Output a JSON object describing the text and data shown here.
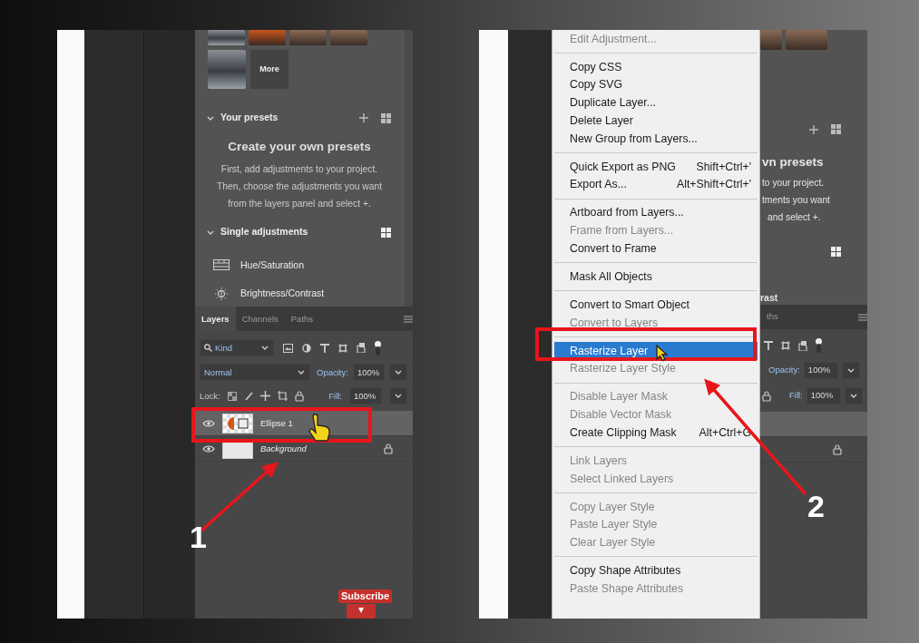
{
  "left_screenshot": {
    "presets": {
      "more_label": "More"
    },
    "your_presets": {
      "title": "Your presets",
      "heading": "Create your own presets",
      "lines": [
        "First, add adjustments to your project.",
        "Then, choose the adjustments you want",
        "from the layers panel and select +."
      ]
    },
    "single_adjustments": {
      "title": "Single adjustments",
      "items": [
        {
          "label": "Hue/Saturation",
          "kind": "hue"
        },
        {
          "label": "Brightness/Contrast",
          "kind": "brightness"
        }
      ]
    },
    "layers_panel": {
      "tabs": [
        {
          "label": "Layers",
          "selected": true
        },
        {
          "label": "Channels",
          "selected": false
        },
        {
          "label": "Paths",
          "selected": false
        }
      ],
      "filter": "Kind",
      "blend_mode": "Normal",
      "opacity_label": "Opacity:",
      "opacity": "100%",
      "lock_label": "Lock:",
      "fill_label": "Fill:",
      "fill": "100%",
      "layers": [
        {
          "name": "Ellipse 1",
          "kind": "shape",
          "selected": true,
          "locked": false
        },
        {
          "name": "Background",
          "kind": "plain",
          "selected": false,
          "locked": true
        }
      ]
    },
    "subscribe_badge": "Subscribe"
  },
  "right_screenshot": {
    "context_menu": {
      "items": [
        {
          "kind": "item",
          "label": "Edit Adjustment...",
          "disabled": true,
          "selected": false
        },
        {
          "kind": "separator"
        },
        {
          "kind": "item",
          "label": "Copy CSS",
          "disabled": false,
          "selected": false
        },
        {
          "kind": "item",
          "label": "Copy SVG",
          "disabled": false,
          "selected": false
        },
        {
          "kind": "item",
          "label": "Duplicate Layer...",
          "disabled": false,
          "selected": false
        },
        {
          "kind": "item",
          "label": "Delete Layer",
          "disabled": false,
          "selected": false
        },
        {
          "kind": "item",
          "label": "New Group from Layers...",
          "disabled": false,
          "selected": false
        },
        {
          "kind": "separator"
        },
        {
          "kind": "item",
          "label": "Quick Export as PNG",
          "shortcut": "Shift+Ctrl+'",
          "disabled": false,
          "selected": false
        },
        {
          "kind": "item",
          "label": "Export As...",
          "shortcut": "Alt+Shift+Ctrl+'",
          "disabled": false,
          "selected": false
        },
        {
          "kind": "separator"
        },
        {
          "kind": "item",
          "label": "Artboard from Layers...",
          "disabled": false,
          "selected": false
        },
        {
          "kind": "item",
          "label": "Frame from Layers...",
          "disabled": true,
          "selected": false
        },
        {
          "kind": "item",
          "label": "Convert to Frame",
          "disabled": false,
          "selected": false
        },
        {
          "kind": "separator"
        },
        {
          "kind": "item",
          "label": "Mask All Objects",
          "disabled": false,
          "selected": false
        },
        {
          "kind": "separator"
        },
        {
          "kind": "item",
          "label": "Convert to Smart Object",
          "disabled": false,
          "selected": false
        },
        {
          "kind": "item",
          "label": "Convert to Layers",
          "disabled": true,
          "selected": false
        },
        {
          "kind": "separator"
        },
        {
          "kind": "item",
          "label": "Rasterize Layer",
          "disabled": false,
          "selected": true
        },
        {
          "kind": "item",
          "label": "Rasterize Layer Style",
          "disabled": true,
          "selected": false
        },
        {
          "kind": "separator"
        },
        {
          "kind": "item",
          "label": "Disable Layer Mask",
          "disabled": true,
          "selected": false
        },
        {
          "kind": "item",
          "label": "Disable Vector Mask",
          "disabled": true,
          "selected": false
        },
        {
          "kind": "item",
          "label": "Create Clipping Mask",
          "shortcut": "Alt+Ctrl+G",
          "disabled": false,
          "selected": false
        },
        {
          "kind": "separator"
        },
        {
          "kind": "item",
          "label": "Link Layers",
          "disabled": true,
          "selected": false
        },
        {
          "kind": "item",
          "label": "Select Linked Layers",
          "disabled": true,
          "selected": false
        },
        {
          "kind": "separator"
        },
        {
          "kind": "item",
          "label": "Copy Layer Style",
          "disabled": true,
          "selected": false
        },
        {
          "kind": "item",
          "label": "Paste Layer Style",
          "disabled": true,
          "selected": false
        },
        {
          "kind": "item",
          "label": "Clear Layer Style",
          "disabled": true,
          "selected": false
        },
        {
          "kind": "separator"
        },
        {
          "kind": "item",
          "label": "Copy Shape Attributes",
          "disabled": false,
          "selected": false
        },
        {
          "kind": "item",
          "label": "Paste Shape Attributes",
          "disabled": true,
          "selected": false
        }
      ]
    },
    "panel_fragments": {
      "heading": "vn presets",
      "lines": [
        "to your project.",
        "tments you want",
        "and select +."
      ],
      "section": "rast",
      "tab": "ths",
      "opacity_label": "Opacity:",
      "opacity": "100%",
      "fill_label": "Fill:",
      "fill": "100%"
    }
  },
  "annotations": [
    {
      "number": "1"
    },
    {
      "number": "2"
    }
  ]
}
